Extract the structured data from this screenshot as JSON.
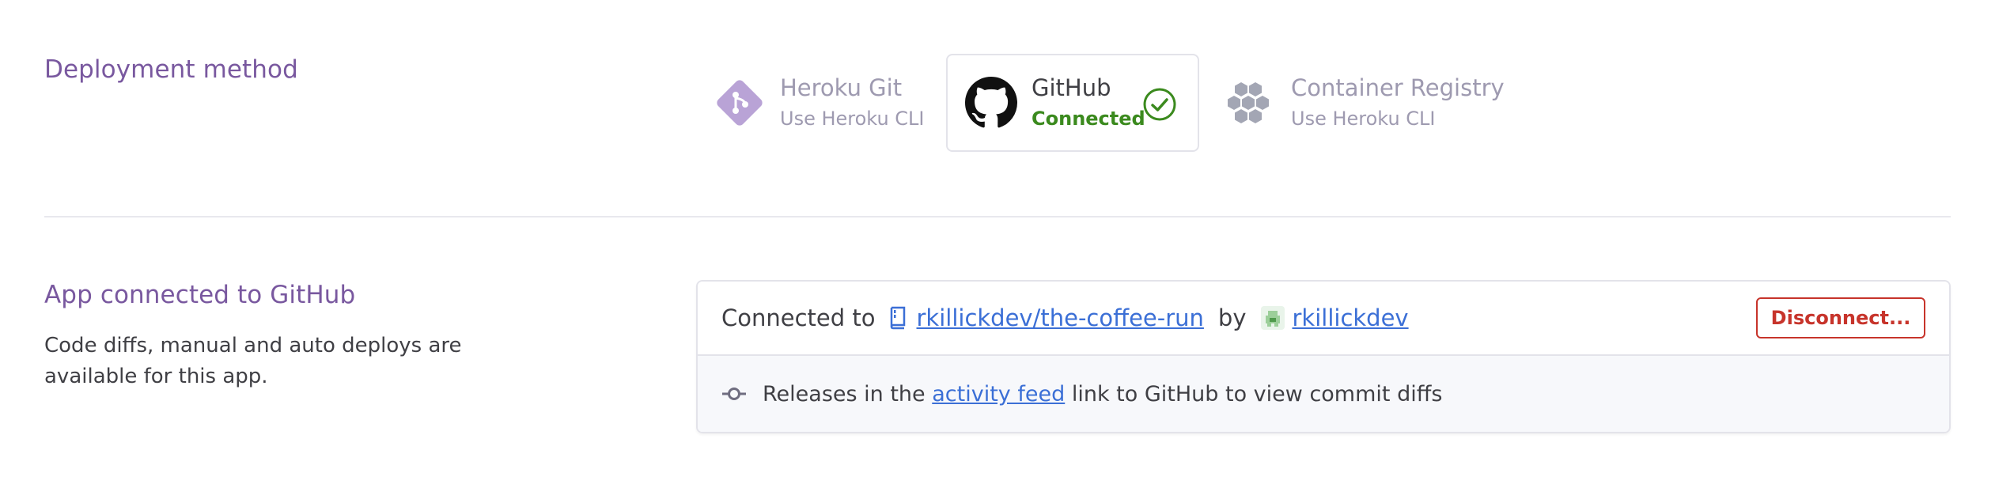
{
  "deployment": {
    "title": "Deployment method",
    "methods": [
      {
        "name": "Heroku Git",
        "sub": "Use Heroku CLI",
        "icon": "heroku-git-icon",
        "selected": false
      },
      {
        "name": "GitHub",
        "sub": "Connected",
        "icon": "github-icon",
        "selected": true
      },
      {
        "name": "Container Registry",
        "sub": "Use Heroku CLI",
        "icon": "container-registry-icon",
        "selected": false
      }
    ]
  },
  "app": {
    "title": "App connected to GitHub",
    "description": "Code diffs, manual and auto deploys are available for this app.",
    "connected_prefix": "Connected to",
    "repo": "rkillickdev/the-coffee-run",
    "by": "by",
    "user": "rkillickdev",
    "disconnect_label": "Disconnect...",
    "releases_prefix": "Releases in the",
    "activity_link": "activity feed",
    "releases_suffix": "link to GitHub to view commit diffs"
  },
  "colors": {
    "section_title": "#79589f",
    "connected_green": "#3b8a1e",
    "link_blue": "#3b6fd6",
    "danger_red": "#c7342b"
  }
}
